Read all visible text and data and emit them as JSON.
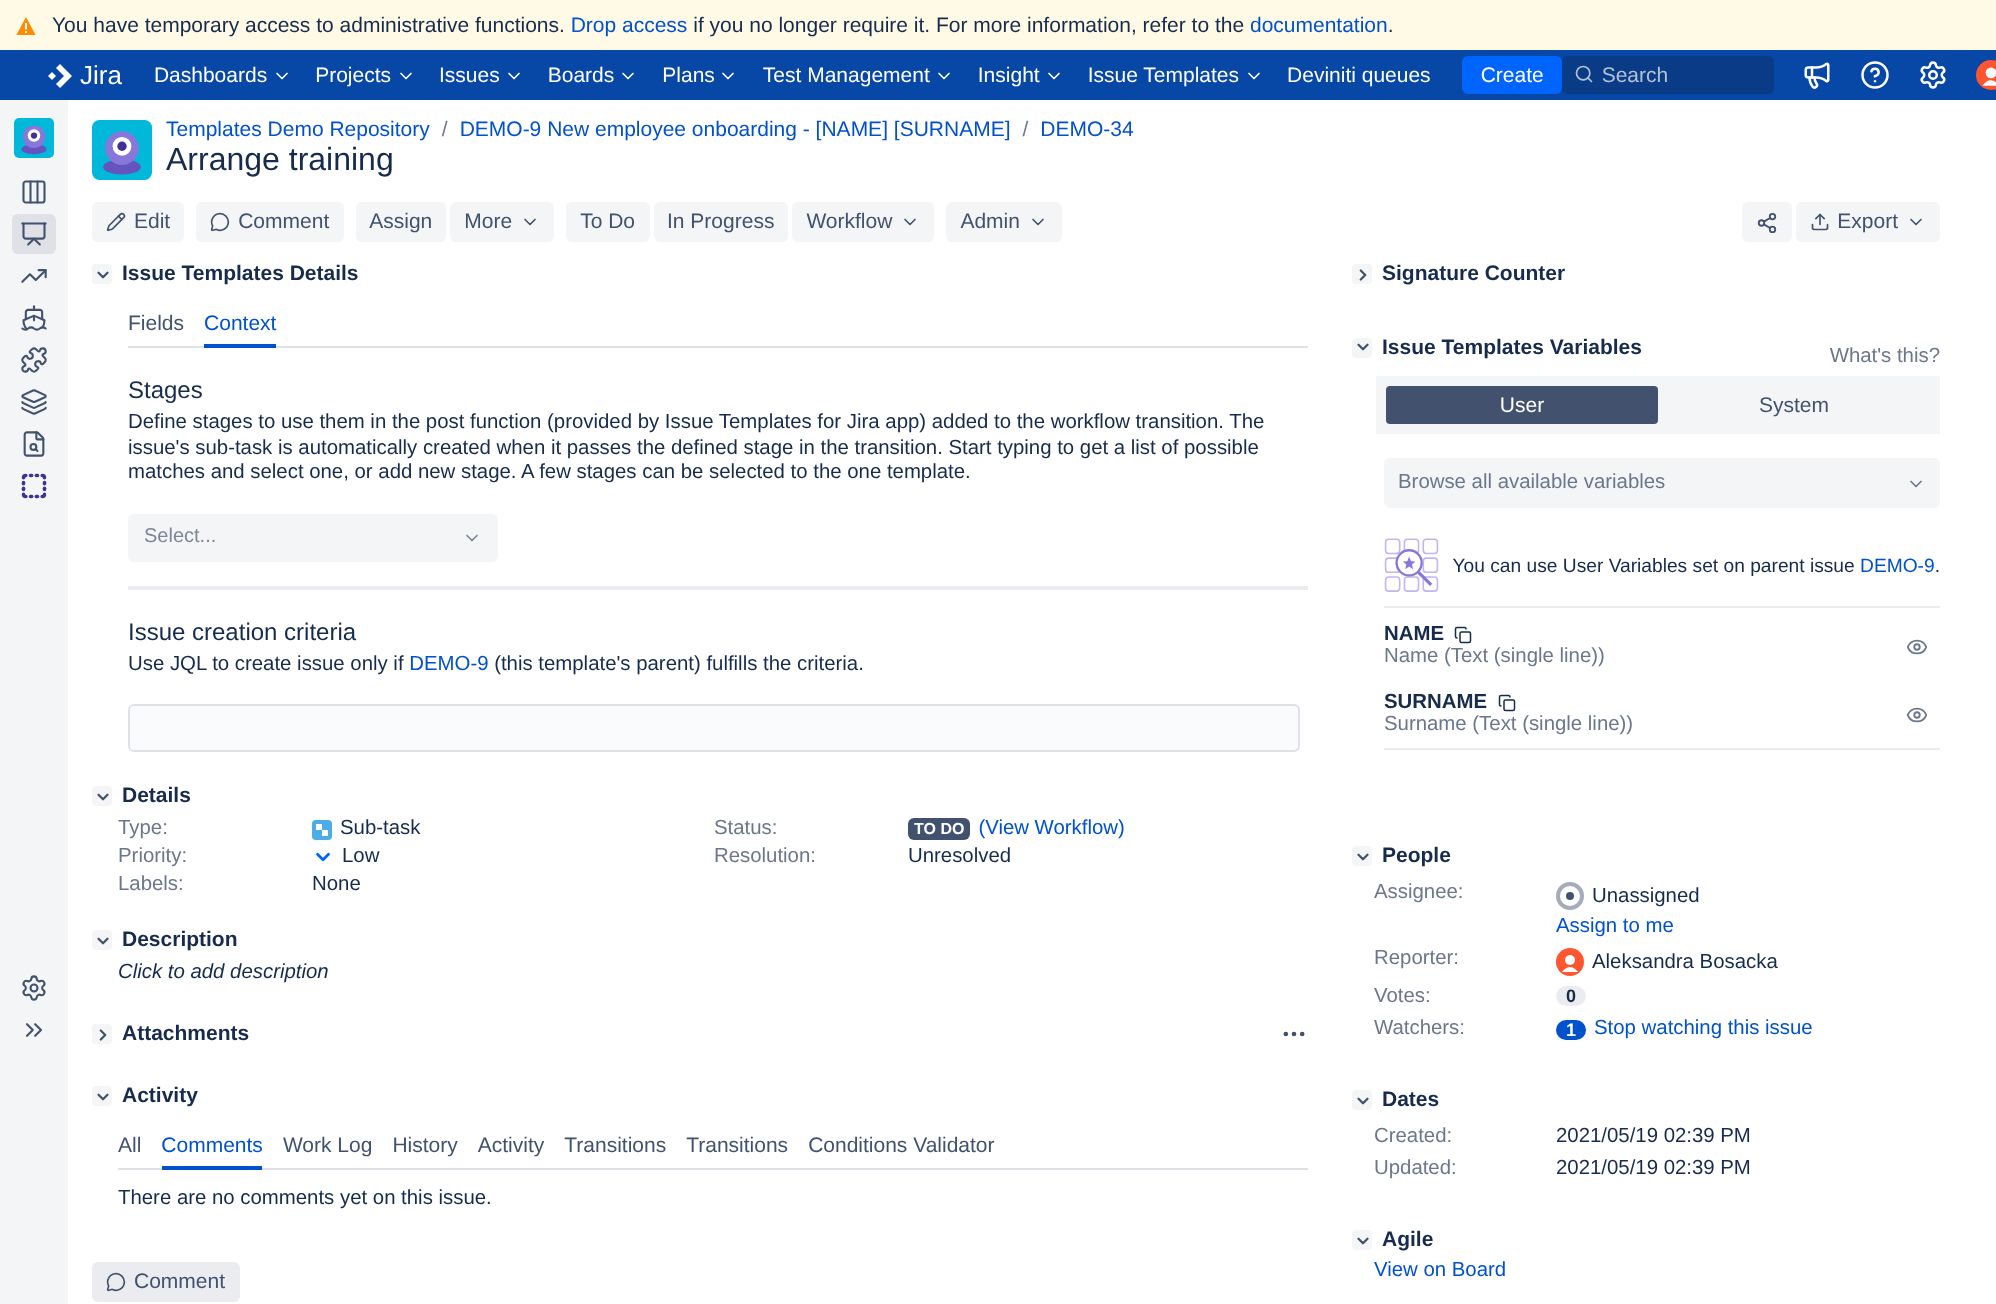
{
  "banner": {
    "before": "You have temporary access to administrative functions. ",
    "link": "Drop access",
    "middle": " if you no longer require it. For more information, refer to the ",
    "link2": "documentation",
    "after": "."
  },
  "nav": {
    "product": "Jira",
    "items": [
      {
        "label": "Dashboards",
        "dropdown": true
      },
      {
        "label": "Projects",
        "dropdown": true
      },
      {
        "label": "Issues",
        "dropdown": true
      },
      {
        "label": "Boards",
        "dropdown": true
      },
      {
        "label": "Plans",
        "dropdown": true
      },
      {
        "label": "Test Management",
        "dropdown": true
      },
      {
        "label": "Insight",
        "dropdown": true
      },
      {
        "label": "Issue Templates",
        "dropdown": true
      },
      {
        "label": "Deviniti queues",
        "dropdown": false
      }
    ],
    "create": "Create",
    "search_placeholder": "Search"
  },
  "sidebar": {
    "items": [
      {
        "kind": "project",
        "selected": false
      },
      {
        "kind": "board",
        "selected": false
      },
      {
        "kind": "screen",
        "selected": true
      },
      {
        "kind": "chart",
        "selected": false
      },
      {
        "kind": "ship",
        "selected": false
      },
      {
        "kind": "puzzle",
        "selected": false
      },
      {
        "kind": "stack",
        "selected": false
      },
      {
        "kind": "search-doc",
        "selected": false
      },
      {
        "kind": "app",
        "selected": false
      }
    ],
    "bottom": [
      {
        "kind": "settings",
        "selected": false
      },
      {
        "kind": "expand",
        "selected": false
      }
    ]
  },
  "breadcrumb_separator": "/",
  "breadcrumbs": [
    "Templates Demo Repository",
    "DEMO-9 New employee onboarding - [NAME] [SURNAME]",
    "DEMO-34"
  ],
  "title": "Arrange training",
  "toolbar": {
    "groups": [
      [
        {
          "label": "Edit",
          "kind": "edit",
          "dropdown": false
        }
      ],
      [
        {
          "label": "Comment",
          "kind": "comment",
          "dropdown": false
        }
      ],
      [
        {
          "label": "Assign",
          "dropdown": false
        },
        {
          "label": "More",
          "dropdown": true
        }
      ],
      [
        {
          "label": "To Do",
          "dropdown": false
        },
        {
          "label": "In Progress",
          "dropdown": false
        },
        {
          "label": "Workflow",
          "dropdown": true
        }
      ],
      [
        {
          "label": "Admin",
          "dropdown": true
        }
      ]
    ],
    "right": [
      {
        "kind": "share",
        "dropdown": false
      },
      {
        "label": "Export",
        "kind": "export",
        "dropdown": true
      }
    ]
  },
  "left_sections": [
    {
      "kind": "templates",
      "title": "Issue Templates Details",
      "expanded": true,
      "tabs": [
        {
          "label": "Fields",
          "selected": false
        },
        {
          "label": "Context",
          "selected": true
        }
      ],
      "stages": {
        "heading": "Stages",
        "text": "Define stages to use them in the post function (provided by Issue Templates for Jira app) added to the workflow transition. The issue's sub-task is automatically created when it passes the defined stage in the transition. Start typing to get a list of possible matches and select one, or add new stage. A few stages can be selected to the one template.",
        "placeholder": "Select..."
      },
      "criteria": {
        "heading": "Issue creation criteria",
        "before": "Use JQL to create issue only if ",
        "link": "DEMO-9",
        "after": " (this template's parent) fulfills the criteria."
      }
    },
    {
      "kind": "details",
      "title": "Details",
      "expanded": true,
      "left": [
        {
          "label": "Type:",
          "value": "Sub-task",
          "kind": "subtask"
        },
        {
          "label": "Priority:",
          "value": "Low",
          "kind": "priority"
        },
        {
          "label": "Labels:",
          "value": "None",
          "kind": "plain"
        }
      ],
      "right": [
        {
          "label": "Status:",
          "lozenge": "TO DO",
          "link": "(View Workflow)"
        },
        {
          "label": "Resolution:",
          "value": "Unresolved"
        }
      ]
    },
    {
      "kind": "description",
      "title": "Description",
      "expanded": true,
      "placeholder": "Click to add description"
    },
    {
      "kind": "attachments",
      "title": "Attachments",
      "expanded": false
    },
    {
      "kind": "activity",
      "title": "Activity",
      "expanded": true,
      "tabs": [
        {
          "label": "All",
          "selected": false
        },
        {
          "label": "Comments",
          "selected": true
        },
        {
          "label": "Work Log",
          "selected": false
        },
        {
          "label": "History",
          "selected": false
        },
        {
          "label": "Activity",
          "selected": false
        },
        {
          "label": "Transitions",
          "selected": false
        },
        {
          "label": "Transitions",
          "selected": false
        },
        {
          "label": "Conditions Validator",
          "selected": false
        }
      ],
      "empty": "There are no comments yet on this issue.",
      "button": "Comment"
    }
  ],
  "right_sections": [
    {
      "kind": "signature",
      "title": "Signature Counter",
      "expanded": false
    },
    {
      "kind": "variables",
      "title": "Issue Templates Variables",
      "expanded": true,
      "help": "What's this?",
      "toggle": [
        {
          "label": "User",
          "selected": true
        },
        {
          "label": "System",
          "selected": false
        }
      ],
      "browse": "Browse all available variables",
      "info": {
        "text": "You can use User Variables set on parent issue ",
        "link": "DEMO-9",
        "after": "."
      },
      "variables": [
        {
          "name": "NAME",
          "type": "Name (Text (single line))"
        },
        {
          "name": "SURNAME",
          "type": "Surname (Text (single line))"
        }
      ]
    },
    {
      "kind": "people",
      "title": "People",
      "expanded": true,
      "fields": [
        {
          "label": "Assignee:",
          "kind": "unassigned",
          "value": "Unassigned",
          "action": "Assign to me"
        },
        {
          "label": "Reporter:",
          "kind": "user",
          "value": "Aleksandra Bosacka"
        },
        {
          "label": "Votes:",
          "kind": "votes",
          "value": "0"
        },
        {
          "label": "Watchers:",
          "kind": "watchers",
          "count": "1",
          "value": "Stop watching this issue"
        }
      ]
    },
    {
      "kind": "dates",
      "title": "Dates",
      "expanded": true,
      "fields": [
        {
          "label": "Created:",
          "value": "2021/05/19 02:39 PM"
        },
        {
          "label": "Updated:",
          "value": "2021/05/19 02:39 PM"
        }
      ]
    },
    {
      "kind": "agile",
      "title": "Agile",
      "expanded": true,
      "link": "View on Board"
    }
  ]
}
